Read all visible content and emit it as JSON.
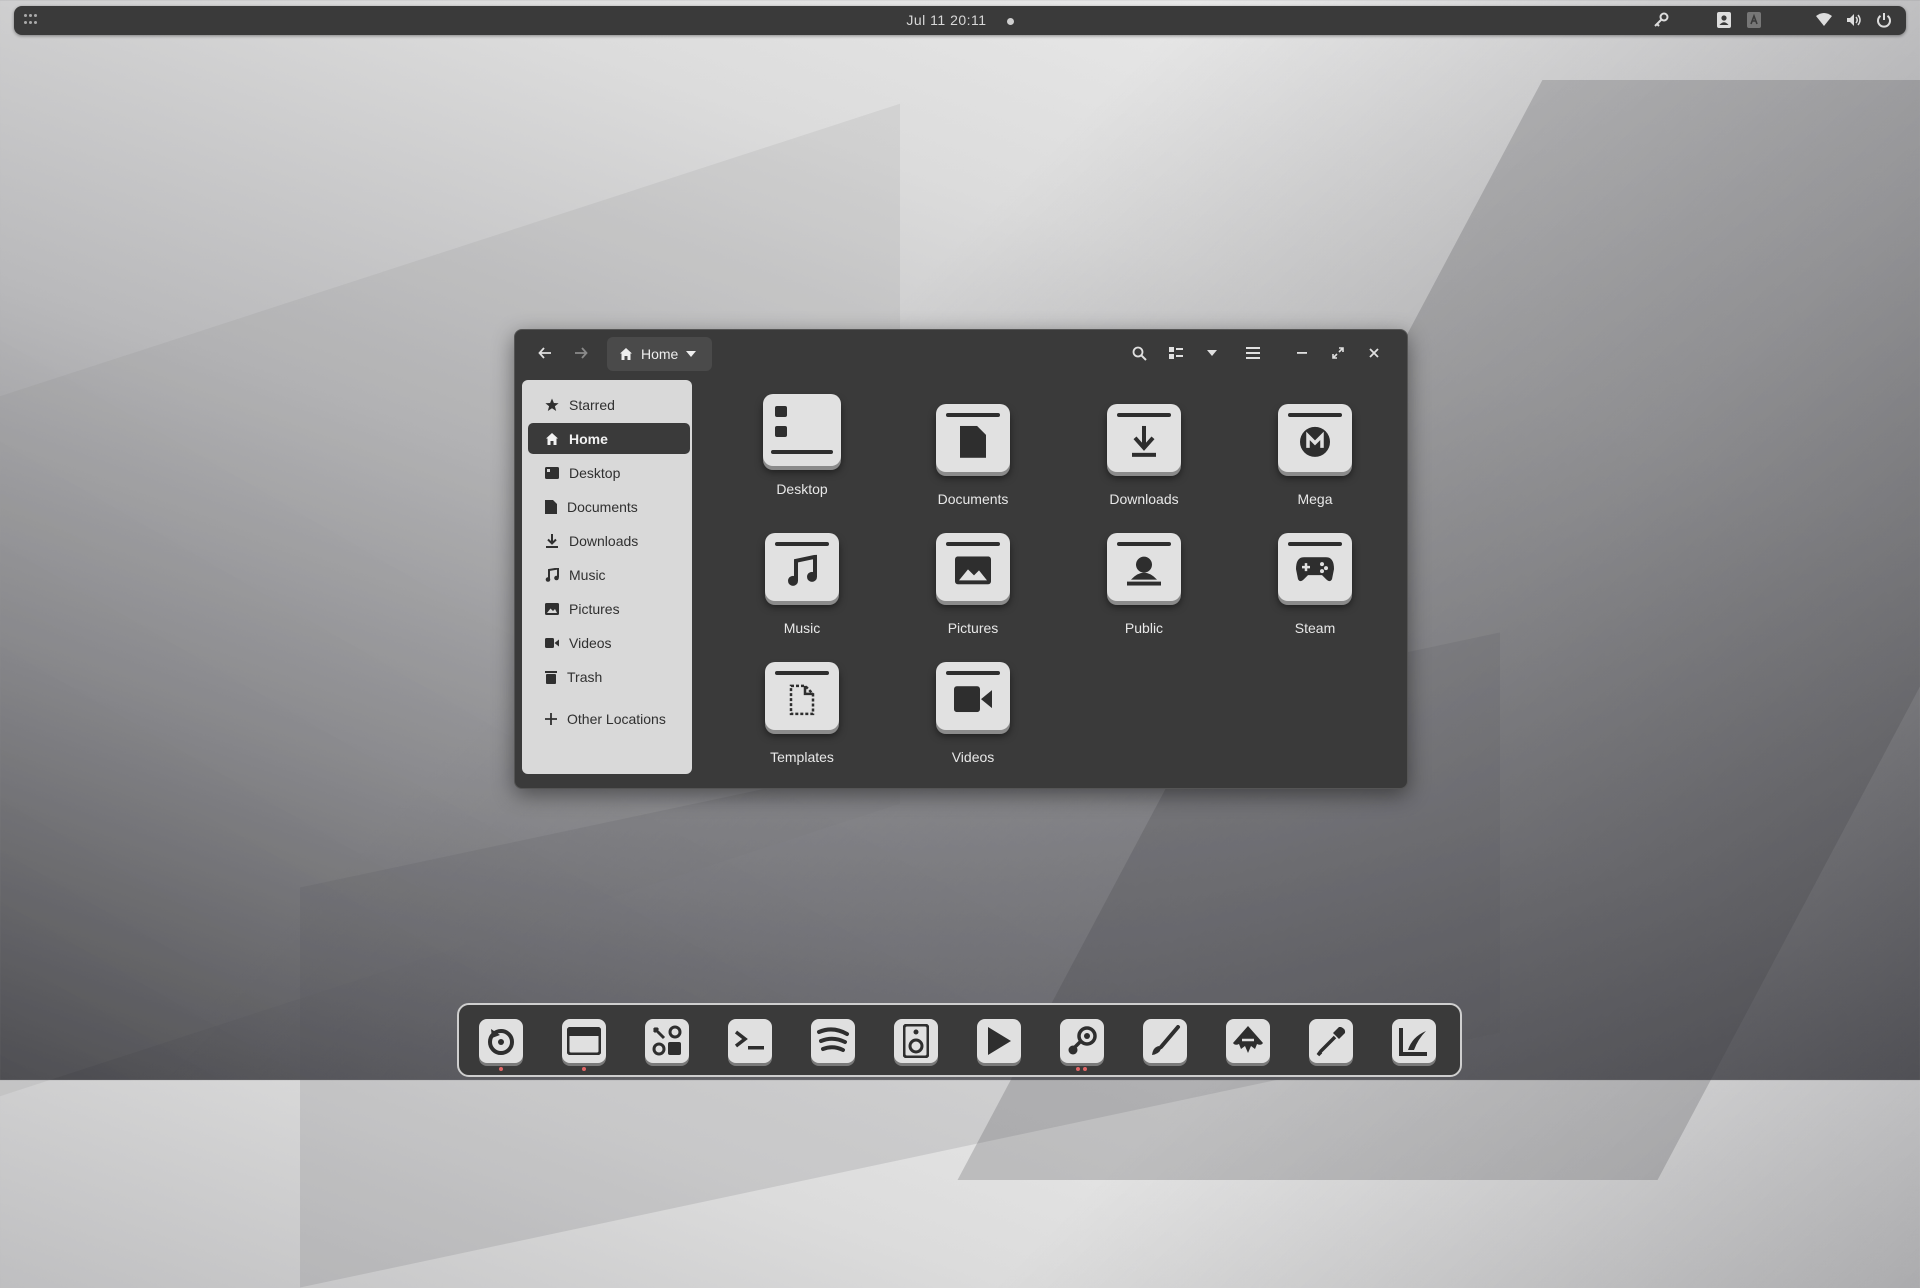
{
  "topbar": {
    "clock": "Jul 11  20:11"
  },
  "window": {
    "pathbar_label": "Home"
  },
  "sidebar": {
    "items": [
      {
        "label": "Starred",
        "icon": "star-icon"
      },
      {
        "label": "Home",
        "icon": "home-icon",
        "active": true
      },
      {
        "label": "Desktop",
        "icon": "desktop-icon"
      },
      {
        "label": "Documents",
        "icon": "document-icon"
      },
      {
        "label": "Downloads",
        "icon": "download-icon"
      },
      {
        "label": "Music",
        "icon": "music-icon"
      },
      {
        "label": "Pictures",
        "icon": "pictures-icon"
      },
      {
        "label": "Videos",
        "icon": "video-icon"
      },
      {
        "label": "Trash",
        "icon": "trash-icon"
      },
      {
        "label": "Other Locations",
        "icon": "plus-icon"
      }
    ]
  },
  "folders": [
    {
      "label": "Desktop",
      "icon": "desktop-folder-icon"
    },
    {
      "label": "Documents",
      "icon": "documents-folder-icon"
    },
    {
      "label": "Downloads",
      "icon": "downloads-folder-icon"
    },
    {
      "label": "Mega",
      "icon": "mega-folder-icon"
    },
    {
      "label": "Music",
      "icon": "music-folder-icon"
    },
    {
      "label": "Pictures",
      "icon": "pictures-folder-icon"
    },
    {
      "label": "Public",
      "icon": "public-folder-icon"
    },
    {
      "label": "Steam",
      "icon": "steam-folder-icon"
    },
    {
      "label": "Templates",
      "icon": "templates-folder-icon"
    },
    {
      "label": "Videos",
      "icon": "videos-folder-icon"
    }
  ],
  "dock": {
    "items": [
      "backup-icon",
      "window-icon",
      "settings-tools-icon",
      "terminal-icon",
      "spotify-icon",
      "speaker-icon",
      "video-player-icon",
      "steam-icon",
      "brush-icon",
      "inkscape-icon",
      "color-picker-icon",
      "krita-icon"
    ]
  }
}
